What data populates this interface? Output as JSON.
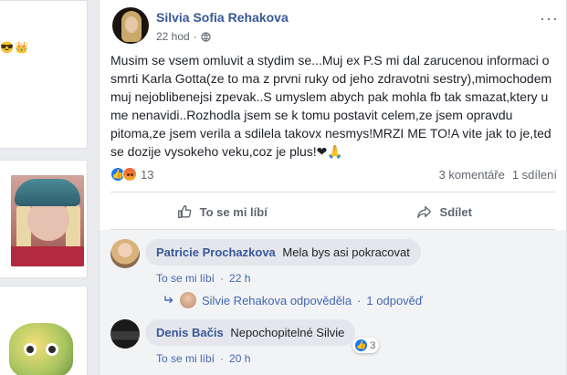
{
  "left": {
    "emojis": [
      "😎",
      "👑"
    ]
  },
  "post": {
    "author": "Silvia Sofia Rehakova",
    "time": "22 hod",
    "meta_separator": "·",
    "more_icon": "···",
    "text": "Musim se vsem omluvit a stydim se...Muj ex P.S mi dal zarucenou informaci o smrti Karla Gotta(ze to ma z prvni ruky od jeho zdravotni sestry),mimochodem muj nejoblibenejsi zpevak..S umyslem abych pak mohla fb tak smazat,ktery u me nenavidi..Rozhodla jsem se k tomu postavit celem,ze jsem opravdu pitoma,ze jsem verila a sdilela takovx nesmys!MRZI ME TO!A vite jak to je,ted se dozije vysokeho veku,coz je plus!❤🙏",
    "reaction_count": "13",
    "comments_count": "3 komentáře",
    "shares_count": "1 sdílení",
    "like_label": "To se mi líbí",
    "share_label": "Sdílet"
  },
  "comments": [
    {
      "author": "Patricie Prochazkova",
      "text": "Mela bys asi pokracovat",
      "like_link": "To se mi líbí",
      "separator": "·",
      "time": "22 h"
    },
    {
      "author": "Denis Bačis",
      "text": "Nepochopitelné Silvie",
      "like_link": "To se mi líbí",
      "separator": "·",
      "time": "20 h",
      "reaction_count": "3"
    }
  ],
  "reply_summary": {
    "text": "Silvie Rehakova odpověděla",
    "separator": "·",
    "count": "1 odpověď"
  },
  "colors": {
    "link": "#385898",
    "accent": "#1877f2",
    "muted": "#606770",
    "heart": "#e0245e"
  }
}
